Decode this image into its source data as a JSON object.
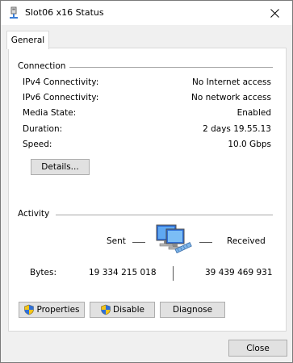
{
  "window": {
    "title": "Slot06 x16 Status",
    "title_icon": "network-adapter-icon",
    "close_icon": "close-icon"
  },
  "tabs": [
    {
      "label": "General",
      "selected": true
    }
  ],
  "connection": {
    "header": "Connection",
    "rows": [
      {
        "label": "IPv4 Connectivity:",
        "value": "No Internet access"
      },
      {
        "label": "IPv6 Connectivity:",
        "value": "No network access"
      },
      {
        "label": "Media State:",
        "value": "Enabled"
      },
      {
        "label": "Duration:",
        "value": "2 days 19.55.13"
      },
      {
        "label": "Speed:",
        "value": "10.0 Gbps"
      }
    ],
    "details_button": "Details..."
  },
  "activity": {
    "header": "Activity",
    "sent_label": "Sent",
    "received_label": "Received",
    "bytes_label": "Bytes:",
    "bytes_sent": "19 334 215 018",
    "bytes_received": "39 439 469 931",
    "icon": "network-computers-icon"
  },
  "buttons": {
    "properties": "Properties",
    "disable": "Disable",
    "diagnose": "Diagnose",
    "close": "Close",
    "shield_icon": "uac-shield-icon"
  },
  "colors": {
    "window_bg": "#f0f0f0",
    "panel_bg": "#ffffff",
    "button_bg": "#e1e1e1",
    "button_border": "#adadad",
    "rule": "#a8a8a8"
  }
}
